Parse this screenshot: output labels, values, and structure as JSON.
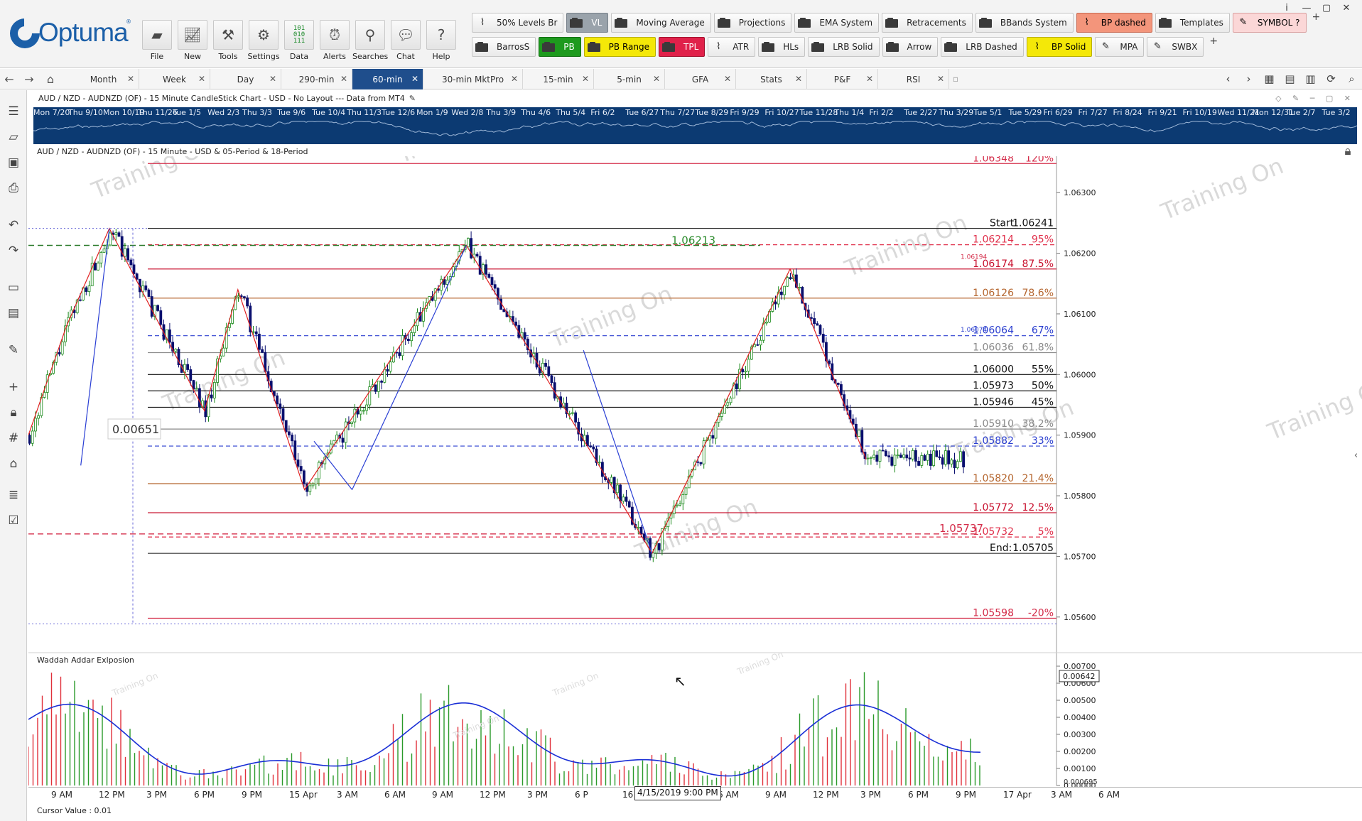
{
  "app": {
    "logo_text": "Optuma",
    "logo_tm": "®"
  },
  "window_controls": [
    "i",
    "—",
    "▢",
    "✕"
  ],
  "main_buttons": [
    {
      "name": "file",
      "label": "File",
      "icon": "folder-icon"
    },
    {
      "name": "new",
      "label": "New",
      "icon": "chart-icon"
    },
    {
      "name": "tools",
      "label": "Tools",
      "icon": "tools-icon"
    },
    {
      "name": "settings",
      "label": "Settings",
      "icon": "gear-icon"
    },
    {
      "name": "data",
      "label": "Data",
      "icon": "binary-icon"
    },
    {
      "name": "alerts",
      "label": "Alerts",
      "icon": "alarm-icon"
    },
    {
      "name": "searches",
      "label": "Searches",
      "icon": "magnifier-icon"
    },
    {
      "name": "chat",
      "label": "Chat",
      "icon": "chat-icon"
    },
    {
      "name": "help",
      "label": "Help",
      "icon": "help-icon"
    }
  ],
  "layout_row1": [
    {
      "label": "50% Levels Br",
      "icon": "chart",
      "style": ""
    },
    {
      "label": "VL",
      "icon": "folder",
      "style": "grey"
    },
    {
      "label": "Moving Average",
      "icon": "folder",
      "style": ""
    },
    {
      "label": "Projections",
      "icon": "folder",
      "style": ""
    },
    {
      "label": "EMA System",
      "icon": "folder",
      "style": ""
    },
    {
      "label": "Retracements",
      "icon": "folder",
      "style": ""
    },
    {
      "label": "BBands System",
      "icon": "folder",
      "style": ""
    },
    {
      "label": "BP dashed",
      "icon": "chart",
      "style": "salmon"
    },
    {
      "label": "Templates",
      "icon": "folder",
      "style": ""
    },
    {
      "label": "SYMBOL ?",
      "icon": "pencil",
      "style": "pink"
    }
  ],
  "layout_row2": [
    {
      "label": "BarrosS",
      "icon": "folder",
      "style": ""
    },
    {
      "label": "PB",
      "icon": "folder",
      "style": "green"
    },
    {
      "label": "PB Range",
      "icon": "folder",
      "style": "yellow"
    },
    {
      "label": "TPL",
      "icon": "folder",
      "style": "red"
    },
    {
      "label": "ATR",
      "icon": "chart",
      "style": ""
    },
    {
      "label": "HLs",
      "icon": "folder",
      "style": ""
    },
    {
      "label": "LRB Solid",
      "icon": "folder",
      "style": ""
    },
    {
      "label": "Arrow",
      "icon": "folder",
      "style": ""
    },
    {
      "label": "LRB Dashed",
      "icon": "folder",
      "style": ""
    },
    {
      "label": "BP Solid",
      "icon": "chart",
      "style": "yellow"
    },
    {
      "label": "MPA",
      "icon": "pencil",
      "style": ""
    },
    {
      "label": "SWBX",
      "icon": "pencil",
      "style": ""
    }
  ],
  "plus_symbol": "+",
  "tabs": [
    {
      "label": "Month",
      "active": false
    },
    {
      "label": "Week",
      "active": false
    },
    {
      "label": "Day",
      "active": false
    },
    {
      "label": "290-min",
      "active": false
    },
    {
      "label": "60-min",
      "active": true
    },
    {
      "label": "30-min MktPro",
      "active": false
    },
    {
      "label": "15-min",
      "active": false
    },
    {
      "label": "5-min",
      "active": false
    },
    {
      "label": "GFA",
      "active": false
    },
    {
      "label": "Stats",
      "active": false
    },
    {
      "label": "P&F",
      "active": false
    },
    {
      "label": "RSI",
      "active": false
    }
  ],
  "chart": {
    "window_title": "AUD / NZD - AUDNZD (OF) - 15 Minute CandleStick Chart - USD - No Layout --- Data from MT4",
    "title": "AUD / NZD - AUDNZD (OF) - 15 Minute - USD & 05-Period & 18-Period",
    "watermark": "Training On",
    "overview_dates": [
      "Mon 7/20",
      "Thu 9/10",
      "Mon 10/19",
      "Thu 11/26",
      "Tue 1/5",
      "Wed 2/3",
      "Thu 3/3",
      "Tue 9/6",
      "Tue 10/4",
      "Thu 11/3",
      "Tue 12/6",
      "Mon 1/9",
      "Wed 2/8",
      "Thu 3/9",
      "Thu 4/6",
      "Thu 5/4",
      "Fri 6/2",
      "Tue 6/27",
      "Thu 7/27",
      "Tue 8/29",
      "Fri 9/29",
      "Fri 10/27",
      "Tue 11/28",
      "Thu 1/4",
      "Fri 2/2",
      "Tue 2/27",
      "Thu 3/29",
      "Tue 5/1",
      "Tue 5/29",
      "Fri 6/29",
      "Fri 7/27",
      "Fri 8/24",
      "Fri 9/21",
      "Fri 10/19",
      "Wed 11/21",
      "Mon 12/31",
      "Tue 2/7",
      "Tue 3/2"
    ],
    "range_box_label": "0.00651",
    "peak_label": "1.06213",
    "low_label": "1.05737",
    "y_axis": {
      "min": 1.0554,
      "max": 1.0636,
      "ticks": [
        "1.06300",
        "1.06200",
        "1.06100",
        "1.06000",
        "1.05900",
        "1.05800",
        "1.05700",
        "1.05600"
      ]
    },
    "fib_levels": [
      {
        "price": 1.06348,
        "price_label": "1.06348",
        "pct": "120%",
        "color": "#d42d4a",
        "dash": false
      },
      {
        "price": 1.06241,
        "price_label": "1.06241",
        "pct": "Start:",
        "color": "#111111",
        "dash": false,
        "kind": "start"
      },
      {
        "price": 1.06214,
        "price_label": "1.06214",
        "pct": "95%",
        "color": "#e0304b",
        "dash": true
      },
      {
        "price": 1.06174,
        "price_label": "1.06174",
        "pct": "87.5%",
        "color": "#c8102e",
        "dash": false
      },
      {
        "price": 1.06126,
        "price_label": "1.06126",
        "pct": "78.6%",
        "color": "#b5662f",
        "dash": false
      },
      {
        "price": 1.06064,
        "price_label": "1.06064",
        "pct": "67%",
        "color": "#2b3fcf",
        "dash": true
      },
      {
        "price": 1.06036,
        "price_label": "1.06036",
        "pct": "61.8%",
        "color": "#8a8a8a",
        "dash": false
      },
      {
        "price": 1.06,
        "price_label": "1.06000",
        "pct": "55%",
        "color": "#111111",
        "dash": false
      },
      {
        "price": 1.05973,
        "price_label": "1.05973",
        "pct": "50%",
        "color": "#111111",
        "dash": false
      },
      {
        "price": 1.05946,
        "price_label": "1.05946",
        "pct": "45%",
        "color": "#111111",
        "dash": false
      },
      {
        "price": 1.0591,
        "price_label": "1.05910",
        "pct": "38.2%",
        "color": "#8a8a8a",
        "dash": false
      },
      {
        "price": 1.05882,
        "price_label": "1.05882",
        "pct": "33%",
        "color": "#2b3fcf",
        "dash": true
      },
      {
        "price": 1.0582,
        "price_label": "1.05820",
        "pct": "21.4%",
        "color": "#b5662f",
        "dash": false
      },
      {
        "price": 1.05772,
        "price_label": "1.05772",
        "pct": "12.5%",
        "color": "#c8102e",
        "dash": false
      },
      {
        "price": 1.05732,
        "price_label": "1.05732",
        "pct": "5%",
        "color": "#e0304b",
        "dash": true
      },
      {
        "price": 1.05705,
        "price_label": "1.05705",
        "pct": "End:",
        "color": "#111111",
        "dash": false,
        "kind": "end"
      },
      {
        "price": 1.05598,
        "price_label": "1.05598",
        "pct": "-20%",
        "color": "#d42d4a",
        "dash": false
      }
    ],
    "small_labels": [
      {
        "text": "1.06194",
        "price": 1.06194,
        "color": "#d42d4a"
      },
      {
        "text": "1.06074",
        "price": 1.06074,
        "color": "#2b3fcf"
      }
    ],
    "zigzag_red": [
      [
        0,
        1.059
      ],
      [
        0.04,
        1.0608
      ],
      [
        0.085,
        1.06241
      ],
      [
        0.185,
        1.0594
      ],
      [
        0.22,
        1.0614
      ],
      [
        0.29,
        1.0581
      ],
      [
        0.46,
        1.06213
      ],
      [
        0.655,
        1.05705
      ],
      [
        0.8,
        1.06174
      ],
      [
        0.88,
        1.0586
      ]
    ],
    "zigzag_blue": [
      [
        0.055,
        1.0585
      ],
      [
        0.085,
        1.06241
      ]
    ],
    "zigzag_blue2": [
      [
        0.34,
        1.0581
      ],
      [
        0.46,
        1.06213
      ]
    ],
    "zigzag_blue3": [
      [
        0.583,
        1.0604
      ],
      [
        0.655,
        1.05705
      ]
    ],
    "zigzag_blue4": [
      [
        0.3,
        1.0589
      ],
      [
        0.34,
        1.0581
      ]
    ],
    "time_labels": [
      "9 AM",
      "12 PM",
      "3 PM",
      "6 PM",
      "9 PM",
      "15 Apr",
      "3 AM",
      "6 AM",
      "9 AM",
      "12 PM",
      "3 PM",
      "6 P",
      "16 Apr",
      "3 AM",
      "6 AM",
      "9 AM",
      "12 PM",
      "3 PM",
      "6 PM",
      "9 PM",
      "17 Apr",
      "3 AM",
      "6 AM"
    ],
    "crosshair_time": "4/15/2019 9:00 PM"
  },
  "indicator": {
    "title": "Waddah Addar Exlposion",
    "y_axis": {
      "min": 0,
      "max": 0.0075,
      "ticks": [
        "0.00700",
        "0.00600",
        "0.00500",
        "0.00400",
        "0.00300",
        "0.00200",
        "0.00100",
        "0.00000"
      ]
    },
    "current_value": "0.00642",
    "bottom_value": "0.000695"
  },
  "status": {
    "cursor_value": "Cursor Value : 0.01"
  }
}
